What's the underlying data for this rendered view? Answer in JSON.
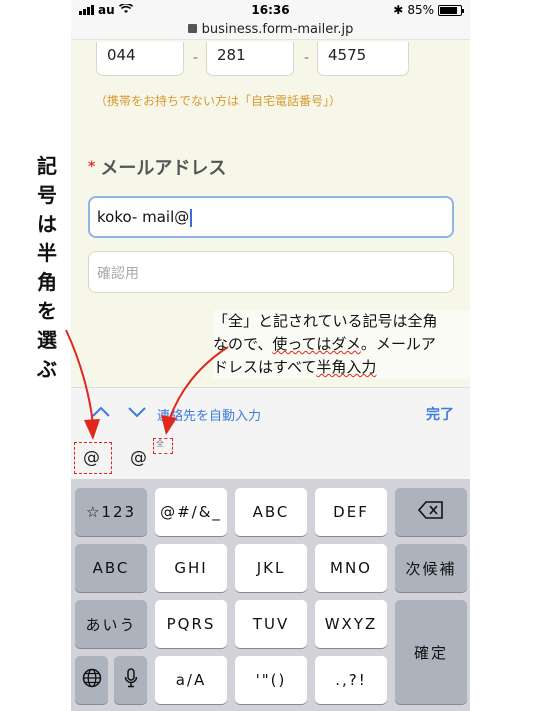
{
  "status_bar": {
    "carrier": "au",
    "time": "16:36",
    "battery": "85%",
    "battery_level": 0.85
  },
  "url_bar": {
    "host": "business.form-mailer.jp"
  },
  "form": {
    "phone": [
      "044",
      "281",
      "4575"
    ],
    "phone_separator": "-",
    "phone_note": "（携帯をお持ちでない方は「自宅電話番号」）",
    "required_mark": "*",
    "email_label": "メールアドレス",
    "email_value": "koko- mail@",
    "confirm_placeholder": "確認用"
  },
  "toolbar": {
    "autofill_label": "連絡先を自動入力",
    "done_label": "完了"
  },
  "suggestions": [
    "@",
    "@"
  ],
  "suggestion_zen_mark": "全",
  "keyboard": {
    "row1": [
      "☆123",
      "@#/&_",
      "ABC",
      "DEF"
    ],
    "row2": [
      "ABC",
      "GHI",
      "JKL",
      "MNO",
      "次候補"
    ],
    "row3": [
      "あいう",
      "PQRS",
      "TUV",
      "WXYZ"
    ],
    "row4": [
      "a/A",
      "'\"()",
      ".,?!"
    ],
    "confirm": "確定"
  },
  "annotations": {
    "vertical_note": "記号は半角を選ぶ",
    "line1": "「全」と記されている記号は全角",
    "line2a": "なので、",
    "line2b": "使ってはダメ",
    "line2c": "。メールア",
    "line3a": "ドレスはすべて",
    "line3b": "半角入力"
  },
  "colors": {
    "accent": "#3d7bdc",
    "annotation_red": "#e0271c",
    "note_orange": "#d79a33"
  }
}
